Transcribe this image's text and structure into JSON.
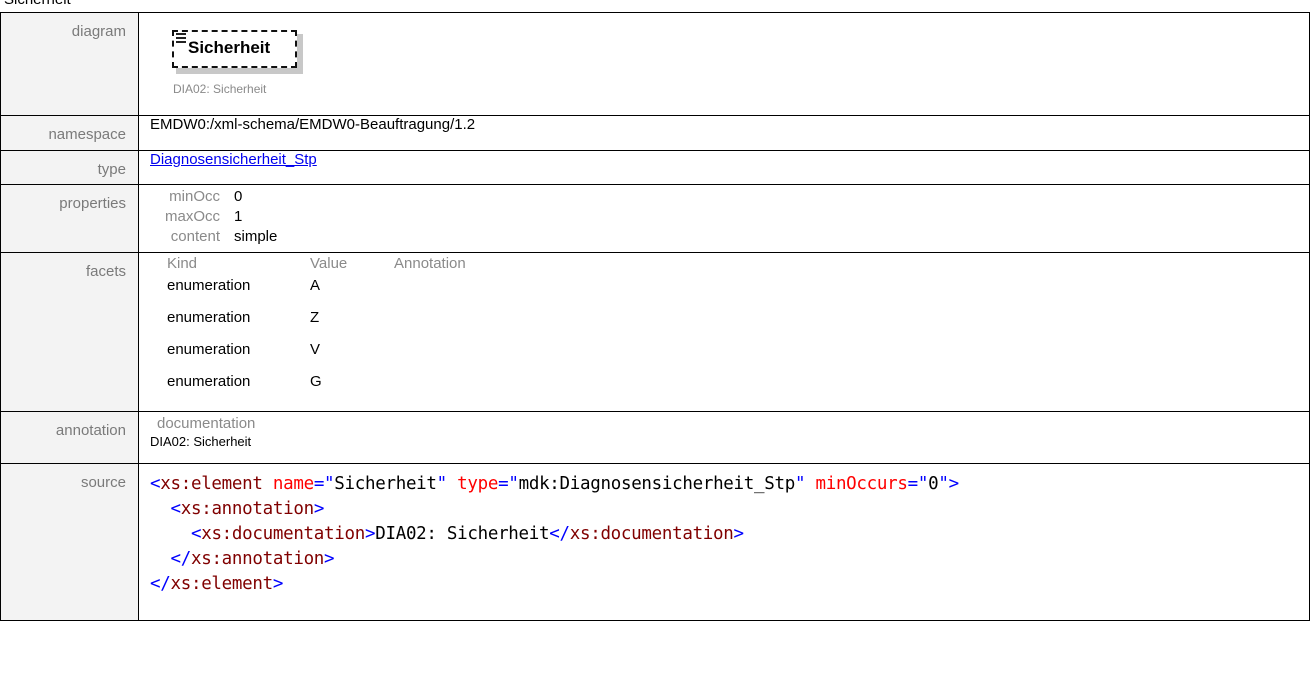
{
  "top_clip": "Sicherheit",
  "rows": {
    "diagram": {
      "label": "diagram",
      "box_title": "Sicherheit",
      "caption": "DIA02: Sicherheit"
    },
    "namespace": {
      "label": "namespace",
      "value": "EMDW0:/xml-schema/EMDW0-Beauftragung/1.2"
    },
    "type": {
      "label": "type",
      "value": "Diagnosensicherheit_Stp"
    },
    "properties": {
      "label": "properties",
      "items": [
        {
          "key": "minOcc",
          "value": "0"
        },
        {
          "key": "maxOcc",
          "value": "1"
        },
        {
          "key": "content",
          "value": "simple"
        }
      ]
    },
    "facets": {
      "label": "facets",
      "headers": [
        "Kind",
        "Value",
        "Annotation"
      ],
      "items": [
        {
          "kind": "enumeration",
          "value": "A"
        },
        {
          "kind": "enumeration",
          "value": "Z"
        },
        {
          "kind": "enumeration",
          "value": "V"
        },
        {
          "kind": "enumeration",
          "value": "G"
        }
      ]
    },
    "annotation": {
      "label": "annotation",
      "key": "documentation",
      "value": "DIA02: Sicherheit"
    },
    "source": {
      "label": "source",
      "lines": [
        [
          {
            "t": "<",
            "c": "br"
          },
          {
            "t": "xs:element",
            "c": "tag"
          },
          {
            "t": " ",
            "c": "tx"
          },
          {
            "t": "name",
            "c": "an"
          },
          {
            "t": "=\"",
            "c": "br"
          },
          {
            "t": "Sicherheit",
            "c": "av"
          },
          {
            "t": "\"",
            "c": "br"
          },
          {
            "t": " ",
            "c": "tx"
          },
          {
            "t": "type",
            "c": "an"
          },
          {
            "t": "=\"",
            "c": "br"
          },
          {
            "t": "mdk:Diagnosensicherheit_Stp",
            "c": "av"
          },
          {
            "t": "\"",
            "c": "br"
          },
          {
            "t": " ",
            "c": "tx"
          },
          {
            "t": "minOccurs",
            "c": "an"
          },
          {
            "t": "=\"",
            "c": "br"
          },
          {
            "t": "0",
            "c": "av"
          },
          {
            "t": "\"",
            "c": "br"
          },
          {
            "t": ">",
            "c": "br"
          }
        ],
        [
          {
            "t": "  ",
            "c": "tx"
          },
          {
            "t": "<",
            "c": "br"
          },
          {
            "t": "xs:annotation",
            "c": "tag"
          },
          {
            "t": ">",
            "c": "br"
          }
        ],
        [
          {
            "t": "    ",
            "c": "tx"
          },
          {
            "t": "<",
            "c": "br"
          },
          {
            "t": "xs:documentation",
            "c": "tag"
          },
          {
            "t": ">",
            "c": "br"
          },
          {
            "t": "DIA02: Sicherheit",
            "c": "tx"
          },
          {
            "t": "</",
            "c": "br"
          },
          {
            "t": "xs:documentation",
            "c": "tag"
          },
          {
            "t": ">",
            "c": "br"
          }
        ],
        [
          {
            "t": "  ",
            "c": "tx"
          },
          {
            "t": "</",
            "c": "br"
          },
          {
            "t": "xs:annotation",
            "c": "tag"
          },
          {
            "t": ">",
            "c": "br"
          }
        ],
        [
          {
            "t": "</",
            "c": "br"
          },
          {
            "t": "xs:element",
            "c": "tag"
          },
          {
            "t": ">",
            "c": "br"
          }
        ]
      ]
    }
  }
}
